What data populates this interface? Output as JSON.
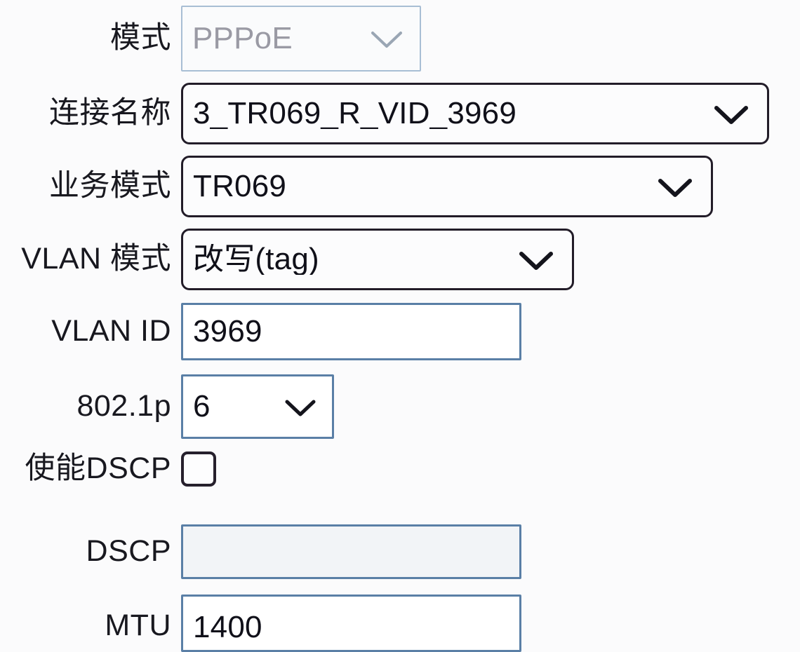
{
  "form": {
    "rows": [
      {
        "id": "mode",
        "label": "模式",
        "control": "select",
        "value": "PPPoE",
        "state": "disabled"
      },
      {
        "id": "connection_name",
        "label": "连接名称",
        "control": "select",
        "value": "3_TR069_R_VID_3969",
        "state": "enabled"
      },
      {
        "id": "service_mode",
        "label": "业务模式",
        "control": "select",
        "value": "TR069",
        "state": "enabled"
      },
      {
        "id": "vlan_mode",
        "label": "VLAN 模式",
        "control": "select",
        "value": "改写(tag)",
        "state": "enabled"
      },
      {
        "id": "vlan_id",
        "label": "VLAN ID",
        "control": "text",
        "value": "3969",
        "state": "enabled"
      },
      {
        "id": "dot1p",
        "label": "802.1p",
        "control": "select",
        "value": "6",
        "state": "enabled"
      },
      {
        "id": "dscp_enable",
        "label": "使能DSCP",
        "control": "checkbox",
        "value": "",
        "checked": false
      },
      {
        "id": "dscp",
        "label": "DSCP",
        "control": "text",
        "value": "",
        "placeholder": "",
        "state": "disabled"
      },
      {
        "id": "mtu",
        "label": "MTU",
        "control": "text",
        "value": "1400",
        "state": "enabled"
      }
    ],
    "icons": {
      "dropdown": "chevron-down-icon",
      "checkbox_unchecked": "checkbox-unchecked-icon"
    },
    "colors": {
      "page_background": "#fbfbfc",
      "active_border": "#221c28",
      "muted_border": "#a8bed4",
      "blue_border": "#5a7fa6",
      "text": "#101019",
      "muted_text": "#9a9aa4",
      "disabled_field_background": "#f2f4f7"
    }
  }
}
